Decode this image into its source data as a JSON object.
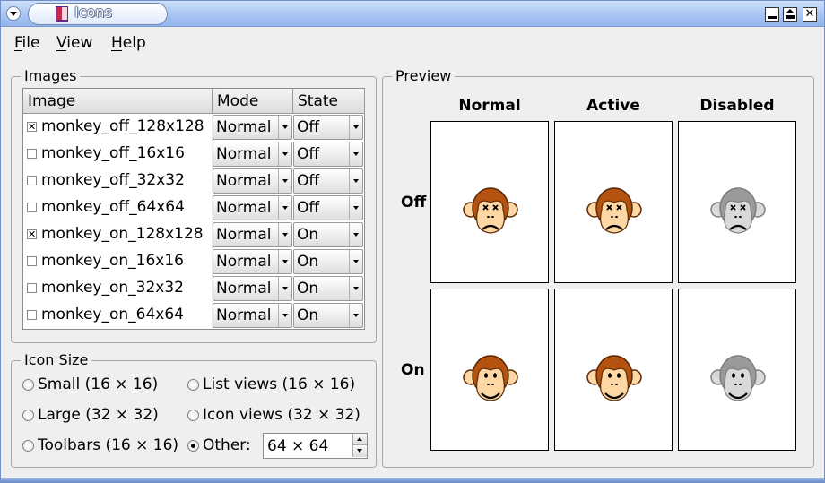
{
  "window": {
    "title": "Icons"
  },
  "menubar": {
    "items": [
      "File",
      "View",
      "Help"
    ]
  },
  "images_group": {
    "title": "Images",
    "columns": [
      "Image",
      "Mode",
      "State"
    ],
    "rows": [
      {
        "name": "monkey_off_128x128",
        "checked": true,
        "mode": "Normal",
        "state": "Off"
      },
      {
        "name": "monkey_off_16x16",
        "checked": false,
        "mode": "Normal",
        "state": "Off"
      },
      {
        "name": "monkey_off_32x32",
        "checked": false,
        "mode": "Normal",
        "state": "Off"
      },
      {
        "name": "monkey_off_64x64",
        "checked": false,
        "mode": "Normal",
        "state": "Off"
      },
      {
        "name": "monkey_on_128x128",
        "checked": true,
        "mode": "Normal",
        "state": "On"
      },
      {
        "name": "monkey_on_16x16",
        "checked": false,
        "mode": "Normal",
        "state": "On"
      },
      {
        "name": "monkey_on_32x32",
        "checked": false,
        "mode": "Normal",
        "state": "On"
      },
      {
        "name": "monkey_on_64x64",
        "checked": false,
        "mode": "Normal",
        "state": "On"
      }
    ]
  },
  "icon_size_group": {
    "title": "Icon Size",
    "options": [
      {
        "label": "Small (16 × 16)",
        "checked": false
      },
      {
        "label": "List views (16 × 16)",
        "checked": false
      },
      {
        "label": "Large (32 × 32)",
        "checked": false
      },
      {
        "label": "Icon views (32 × 32)",
        "checked": false
      },
      {
        "label": "Toolbars (16 × 16)",
        "checked": false
      },
      {
        "label": "Other:",
        "checked": true
      }
    ],
    "other_value": "64 × 64"
  },
  "preview_group": {
    "title": "Preview",
    "columns": [
      "Normal",
      "Active",
      "Disabled"
    ],
    "rows": [
      "Off",
      "On"
    ]
  },
  "colors": {
    "monkey_fur": "#b5520f",
    "monkey_face": "#fdd7a4",
    "disabled_fur": "#9a9a9a",
    "disabled_face": "#d9d9d9"
  }
}
